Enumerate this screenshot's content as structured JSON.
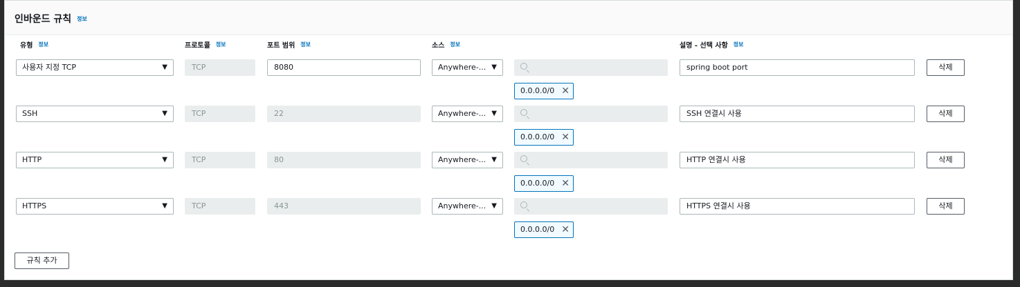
{
  "section": {
    "title": "인바운드 규칙",
    "info": "정보"
  },
  "columns": {
    "type": "유형",
    "protocol": "프로토콜",
    "port_range": "포트 범위",
    "source": "소스",
    "description": "설명 - 선택 사항",
    "info": "정보"
  },
  "rules": [
    {
      "type": "사용자 지정 TCP",
      "protocol": "TCP",
      "port": "8080",
      "port_editable": true,
      "source": "Anywhere-...",
      "cidr": "0.0.0.0/0",
      "description": "spring boot port",
      "delete": "삭제"
    },
    {
      "type": "SSH",
      "protocol": "TCP",
      "port": "22",
      "port_editable": false,
      "source": "Anywhere-...",
      "cidr": "0.0.0.0/0",
      "description": "SSH 연결시 사용",
      "delete": "삭제"
    },
    {
      "type": "HTTP",
      "protocol": "TCP",
      "port": "80",
      "port_editable": false,
      "source": "Anywhere-...",
      "cidr": "0.0.0.0/0",
      "description": "HTTP 연결시 사용",
      "delete": "삭제"
    },
    {
      "type": "HTTPS",
      "protocol": "TCP",
      "port": "443",
      "port_editable": false,
      "source": "Anywhere-...",
      "cidr": "0.0.0.0/0",
      "description": "HTTPS 연결시 사용",
      "delete": "삭제"
    }
  ],
  "add_rule_label": "규칙 추가",
  "colors": {
    "link": "#0073bb",
    "token_border": "#0073bb",
    "disabled_bg": "#eaeded"
  }
}
